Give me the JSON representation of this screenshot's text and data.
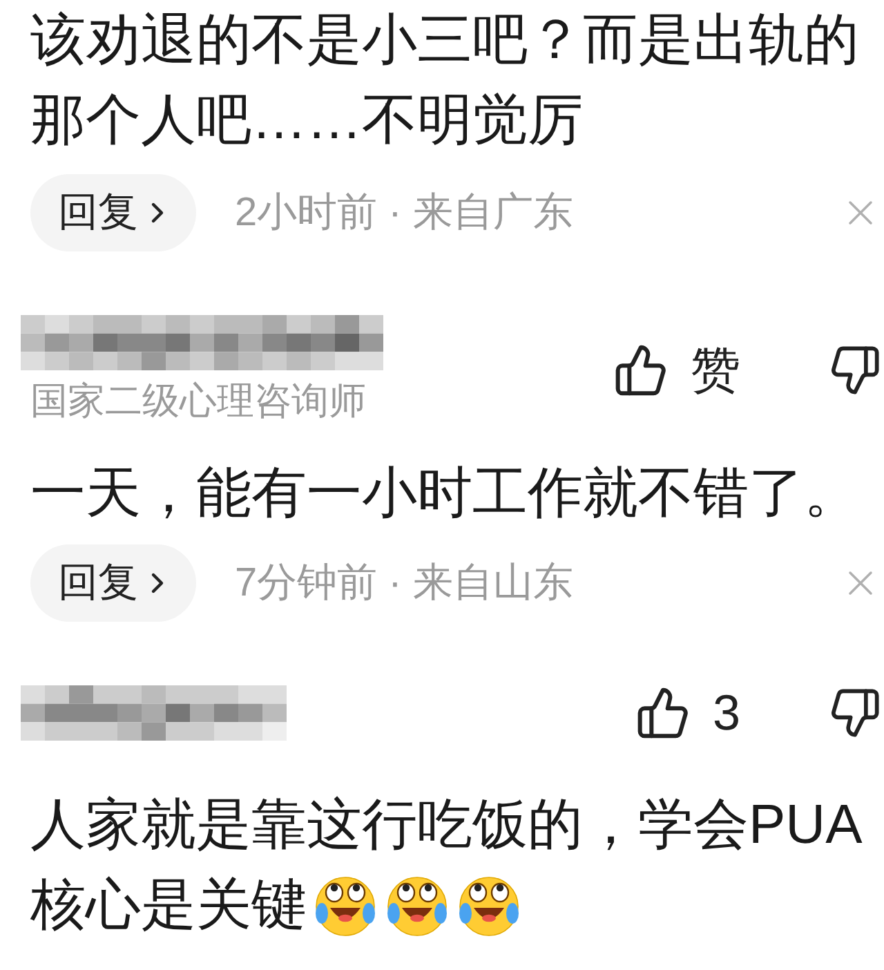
{
  "comments": [
    {
      "text": "该劝退的不是小三吧？而是出轨的那个人吧……不明觉厉",
      "reply": {
        "label": "回复",
        "meta": "2小时前 · 来自广东"
      }
    },
    {
      "author": {
        "mosaic": true,
        "title": "国家二级心理咨询师"
      },
      "like_label": "赞",
      "text": "一天，能有一小时工作就不错了。",
      "reply": {
        "label": "回复",
        "meta": "7分钟前 · 来自山东"
      }
    },
    {
      "author": {
        "mosaic": true
      },
      "like_label": "3",
      "text_lines": [
        "人家就是靠这行吃饭的，学会PUA",
        "核心是关键"
      ],
      "emojis": [
        {
          "kind": "laughing-tears"
        },
        {
          "kind": "laughing-tears"
        },
        {
          "kind": "laughing-tears"
        }
      ]
    }
  ]
}
